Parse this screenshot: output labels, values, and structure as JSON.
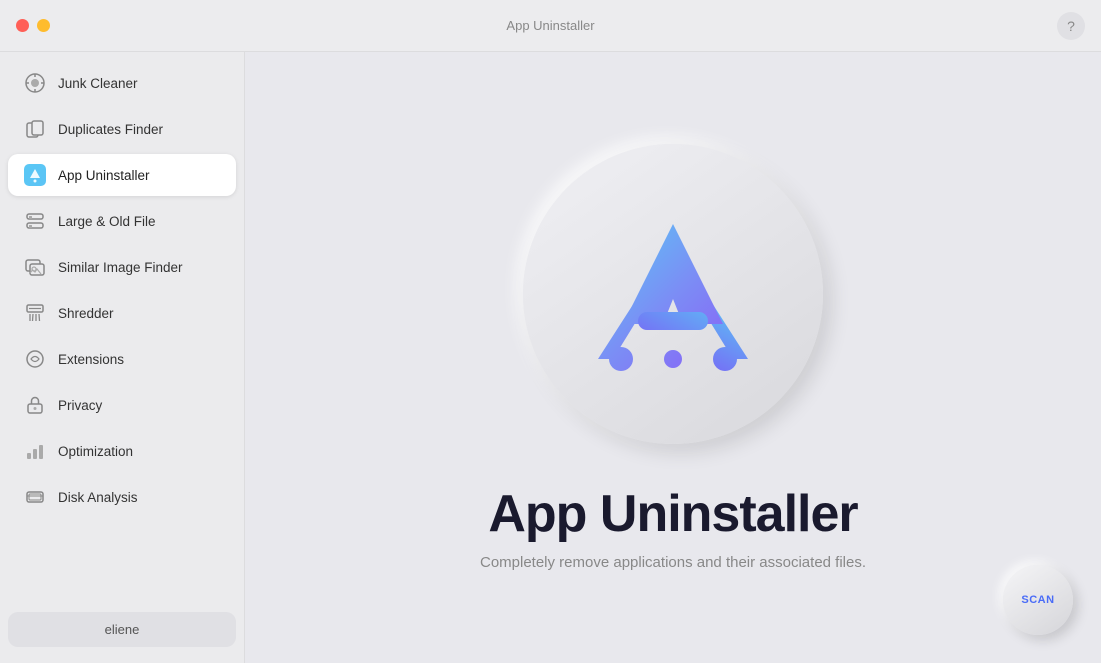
{
  "titlebar": {
    "app_name": "App Uninstaller",
    "help_label": "?"
  },
  "sidebar": {
    "items": [
      {
        "id": "junk-cleaner",
        "label": "Junk Cleaner",
        "active": false
      },
      {
        "id": "duplicates-finder",
        "label": "Duplicates Finder",
        "active": false
      },
      {
        "id": "app-uninstaller",
        "label": "App Uninstaller",
        "active": true
      },
      {
        "id": "large-old-file",
        "label": "Large & Old File",
        "active": false
      },
      {
        "id": "similar-image-finder",
        "label": "Similar Image Finder",
        "active": false
      },
      {
        "id": "shredder",
        "label": "Shredder",
        "active": false
      },
      {
        "id": "extensions",
        "label": "Extensions",
        "active": false
      },
      {
        "id": "privacy",
        "label": "Privacy",
        "active": false
      },
      {
        "id": "optimization",
        "label": "Optimization",
        "active": false
      },
      {
        "id": "disk-analysis",
        "label": "Disk Analysis",
        "active": false
      }
    ],
    "user_label": "eliene"
  },
  "content": {
    "title": "App Uninstaller",
    "subtitle": "Completely remove applications and their associated files.",
    "scan_button_label": "SCAN"
  },
  "traffic_lights": {
    "red_color": "#ff5f57",
    "yellow_color": "#febc2e"
  }
}
